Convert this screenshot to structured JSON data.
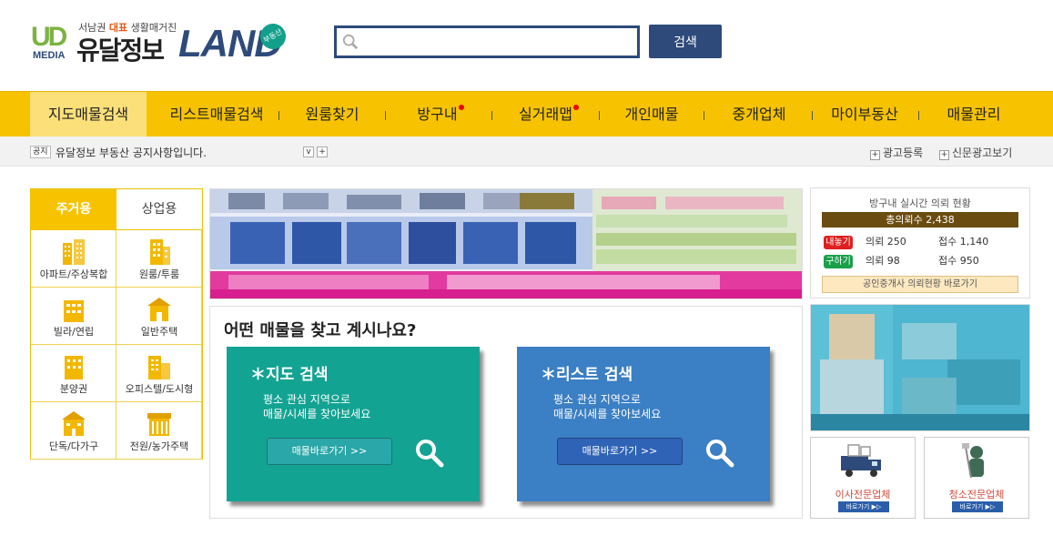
{
  "header": {
    "tagline_prefix": "서남권 ",
    "tagline_highlight": "대표",
    "tagline_suffix": " 생활매거진",
    "logo_ud": "UD",
    "logo_media": "MEDIA",
    "brand_name": "유달정보",
    "brand_land": "LAND",
    "brand_badge": "부동산",
    "search_placeholder": "",
    "search_button": "검색"
  },
  "nav": {
    "items": [
      {
        "label": "지도매물검색",
        "active": true
      },
      {
        "label": "리스트매물검색"
      },
      {
        "label": "원룸찾기"
      },
      {
        "label": "방구내",
        "dot": true
      },
      {
        "label": "실거래맵",
        "dot": true
      },
      {
        "label": "개인매물"
      },
      {
        "label": "중개업체"
      },
      {
        "label": "마이부동산"
      },
      {
        "label": "매물관리"
      }
    ]
  },
  "notice": {
    "tag": "공지",
    "text": "유달정보 부동산 공지사항입니다.",
    "ctrl_down": "v",
    "ctrl_plus": "+",
    "link_ad": "광고등록",
    "link_paper": "신문광고보기",
    "plus": "+"
  },
  "left_panel": {
    "tabs": [
      "주거용",
      "상업용"
    ],
    "categories": [
      "아파트/주상복합",
      "원룸/투룸",
      "빌라/연립",
      "일반주택",
      "분양권",
      "오피스텔/도시형",
      "단독/다가구",
      "전원/농가주택"
    ]
  },
  "find": {
    "title": "어떤 매물을 찾고 계시나요?",
    "map_title": "＊지도 검색",
    "map_desc": "평소 관심 지역으로\n매물/시세를 찾아보세요",
    "map_button": "매물바로가기 >>",
    "list_title": "＊리스트 검색",
    "list_desc": "평소 관심 지역으로\n매물/시세를 찾아보세요",
    "list_button": "매물바로가기 >>"
  },
  "right_panel": {
    "title": "방구내 실시간 의뢰 현황",
    "total": "총의뢰수 2,438",
    "rows": [
      {
        "tag": "내놓기",
        "tag_color": "#e02020",
        "req": "의뢰 250",
        "done": "접수 1,140"
      },
      {
        "tag": "구하기",
        "tag_color": "#1aa04a",
        "req": "의뢰 98",
        "done": "접수 950"
      }
    ],
    "link": "공인중개사 의뢰현황 바로가기",
    "services": [
      {
        "name": "이사전문업체",
        "go": "바로가기 ▶▷"
      },
      {
        "name": "청소전문업체",
        "go": "바로가기 ▶▷"
      }
    ]
  },
  "colors": {
    "accent": "#f7c300",
    "navy": "#2d4a7a",
    "teal": "#13a392",
    "blue": "#3b7fc4"
  }
}
